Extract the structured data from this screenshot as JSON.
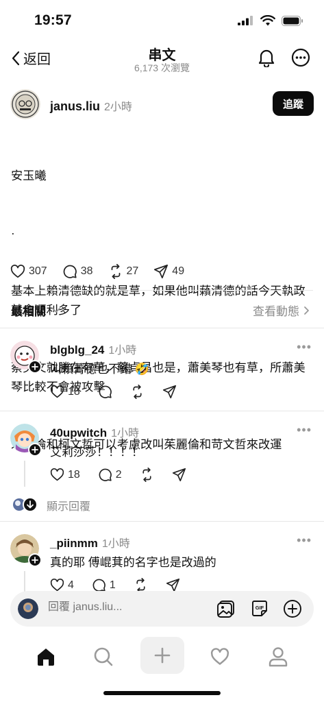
{
  "status_bar": {
    "time": "19:57"
  },
  "header": {
    "back_label": "返回",
    "title": "串文",
    "views": "6,173 次瀏覽"
  },
  "post": {
    "author": "janus.liu",
    "time": "2小時",
    "follow_label": "追蹤",
    "lines": [
      "安玉曦",
      "·",
      "基本上賴清德缺的就是草，如果他叫藾清德的話今天執政就會順利多了",
      "蔡英文就勝在有草，蘇貞昌也是，蕭美琴也有草，所蕭美琴比較不會被攻擊",
      "朱立倫和柯文哲可以考慮改叫茱麗倫和苛文哲來改運"
    ],
    "likes": "307",
    "comments": "38",
    "reposts": "27",
    "shares": "49"
  },
  "sort": {
    "label": "最相關",
    "activity_label": "查看動態"
  },
  "replies": [
    {
      "author": "blgblg_24",
      "time": "1小時",
      "text": "叫賴菁德也不錯 🤣",
      "likes": "18",
      "comments": ""
    },
    {
      "author": "40upwitch",
      "time": "1小時",
      "text": "艾莉莎莎！！！！",
      "likes": "18",
      "comments": "2"
    },
    {
      "author": "_piinmm",
      "time": "1小時",
      "text": "真的耶 傅崐萁的名字也是改過的",
      "likes": "4",
      "comments": "1"
    }
  ],
  "show_replies_label": "顯示回覆",
  "composer": {
    "placeholder": "回覆 janus.liu..."
  },
  "icons": {
    "back": "chevron-left-icon",
    "bell": "bell-icon",
    "more": "more-circle-icon",
    "like": "heart-icon",
    "comment": "comment-icon",
    "repost": "repost-icon",
    "share": "share-icon"
  }
}
